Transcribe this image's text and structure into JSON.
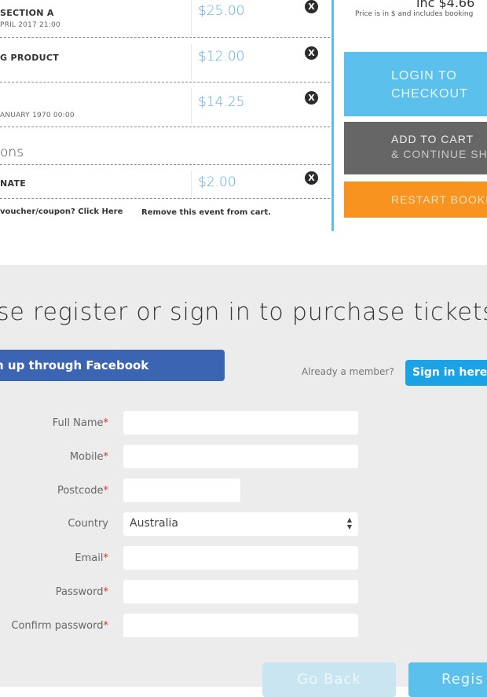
{
  "cart": {
    "items": [
      {
        "title": "SECTION A",
        "subtitle": "PRIL 2017 21:00",
        "price": "$25.00",
        "remove_label": "X"
      },
      {
        "title": "G PRODUCT",
        "subtitle": "",
        "price": "$12.00",
        "remove_label": "X"
      },
      {
        "title": "",
        "subtitle": "ANUARY 1970 00:00",
        "price": "$14.25",
        "remove_label": "X"
      }
    ],
    "section_heading": "ons",
    "donation": {
      "title": "NATE",
      "price": "$2.00",
      "remove_label": "X"
    },
    "voucher_text": "voucher/coupon? Click Here",
    "remove_event_text": "Remove this event from cart."
  },
  "summary": {
    "total_text": "inc $4.66",
    "price_note": "Price is in $ and includes booking",
    "login_label_1": "LOGIN TO",
    "login_label_2": "CHECKOUT",
    "add_label_1": "ADD TO CART",
    "add_label_2": "& CONTINUE SHO",
    "restart_label": "RESTART BOOKI"
  },
  "register": {
    "title": "se register or sign in to purchase tickets",
    "facebook_label": "n up through Facebook",
    "already_member": "Already a member?",
    "sign_in_label": "Sign in here",
    "fields": {
      "full_name": "Full Name",
      "mobile": "Mobile",
      "postcode": "Postcode",
      "country": "Country",
      "email": "Email",
      "password": "Password",
      "confirm_password": "Confirm password"
    },
    "required_mark": "*",
    "country_value": "Australia",
    "go_back_label": "Go Back",
    "register_label": "Regis"
  },
  "colors": {
    "accent_blue": "#5bc0eb",
    "facebook_blue": "#3b65b3",
    "sign_in_blue": "#1ba3e5",
    "grey_button": "#666666",
    "orange_button": "#f7931e",
    "required_red": "#d9322c"
  },
  "icons": {
    "remove": "close-circle-icon",
    "select_arrows": "updown-arrows-icon"
  }
}
